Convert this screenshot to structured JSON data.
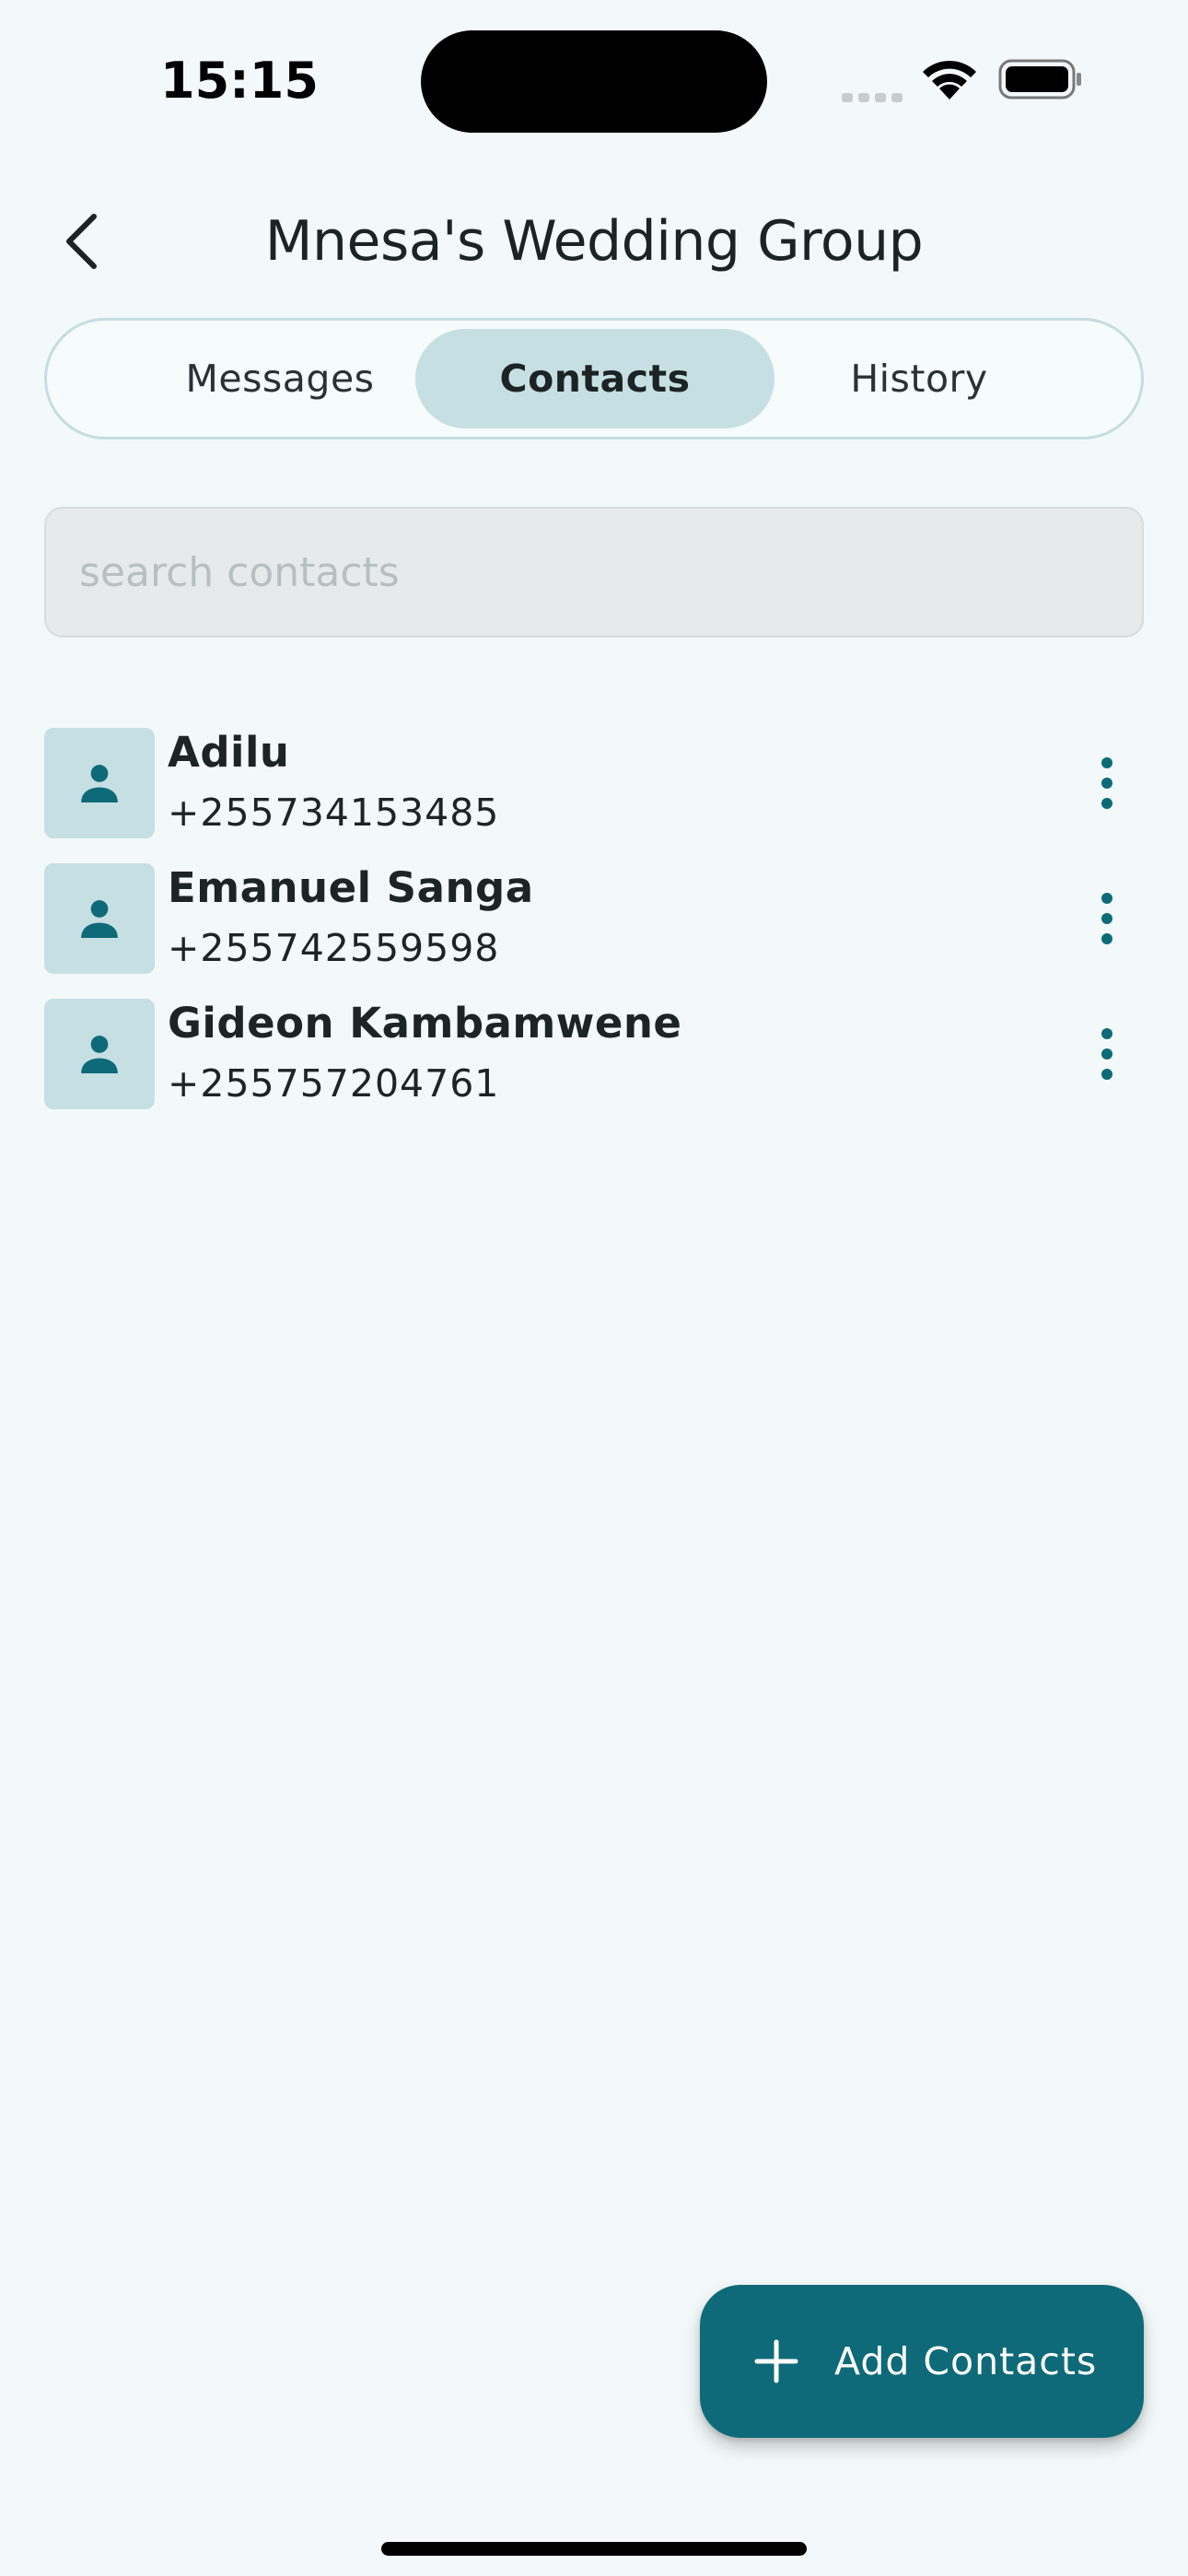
{
  "status_bar": {
    "time": "15:15"
  },
  "header": {
    "title": "Mnesa's Wedding Group",
    "back_icon": "chevron-left-icon"
  },
  "tabs": [
    {
      "label": "Messages",
      "selected": false
    },
    {
      "label": "Contacts",
      "selected": true
    },
    {
      "label": "History",
      "selected": false
    }
  ],
  "search": {
    "placeholder": "search contacts",
    "value": ""
  },
  "contacts": [
    {
      "name": "Adilu",
      "phone": "+255734153485"
    },
    {
      "name": "Emanuel Sanga",
      "phone": "+255742559598"
    },
    {
      "name": "Gideon Kambamwene",
      "phone": "+255757204761"
    }
  ],
  "fab": {
    "label": "Add Contacts",
    "icon": "plus-icon"
  },
  "colors": {
    "background": "#f3f9fa",
    "accent": "#0e6a78",
    "tab_selected": "#c6dfe3",
    "avatar_bg": "#c6dfe3",
    "search_bg": "#e6eaeb"
  }
}
